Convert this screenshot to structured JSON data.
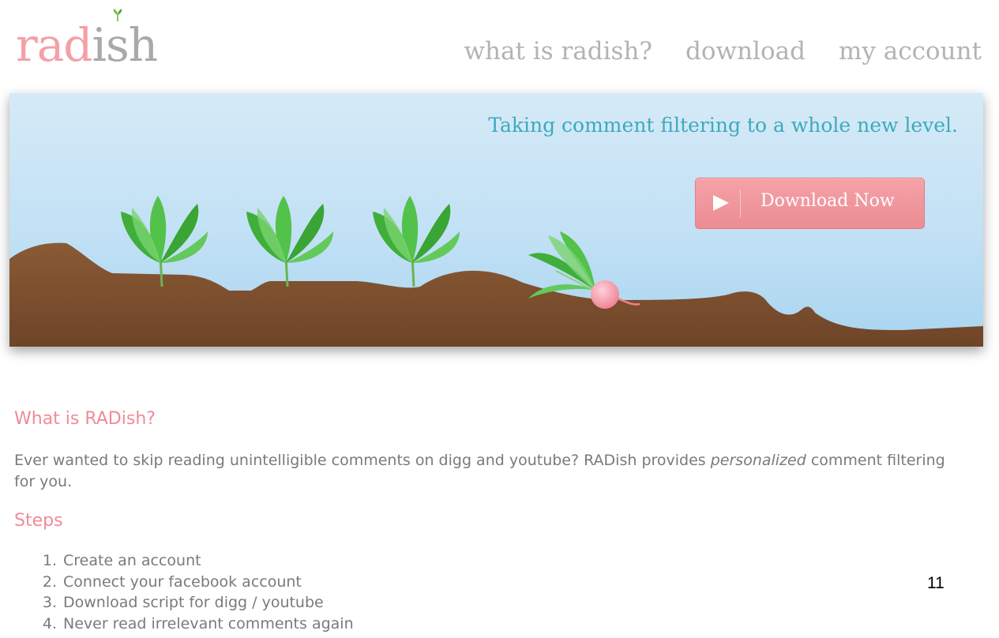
{
  "brand": {
    "logo_text_pink": "rad",
    "logo_text_gray": "ish"
  },
  "nav": {
    "items": [
      {
        "label": "what is radish?"
      },
      {
        "label": "download"
      },
      {
        "label": "my account"
      }
    ]
  },
  "hero": {
    "tagline": "Taking comment filtering to a whole new level.",
    "download_button": {
      "label": "Download Now",
      "icon": "play-icon"
    }
  },
  "content": {
    "what_title": "What is RADish?",
    "intro_before": "Ever wanted to skip reading unintelligible comments on digg and youtube? RADish provides ",
    "intro_emphasis": "personalized",
    "intro_after": " comment filtering for you.",
    "steps_title": "Steps",
    "steps": [
      {
        "num": "1.",
        "text": "Create an account"
      },
      {
        "num": "2.",
        "text": "Connect your facebook account"
      },
      {
        "num": "3.",
        "text": "Download script for digg / youtube"
      },
      {
        "num": "4.",
        "text": "Never read irrelevant comments again"
      }
    ]
  },
  "page_number": "11",
  "colors": {
    "brand_pink": "#f4a0a6",
    "heading_pink": "#f08a98",
    "tagline_teal": "#3fa9bc",
    "soil_brown": "#7a4c2c",
    "sky_blue": "#c2e1f5"
  }
}
